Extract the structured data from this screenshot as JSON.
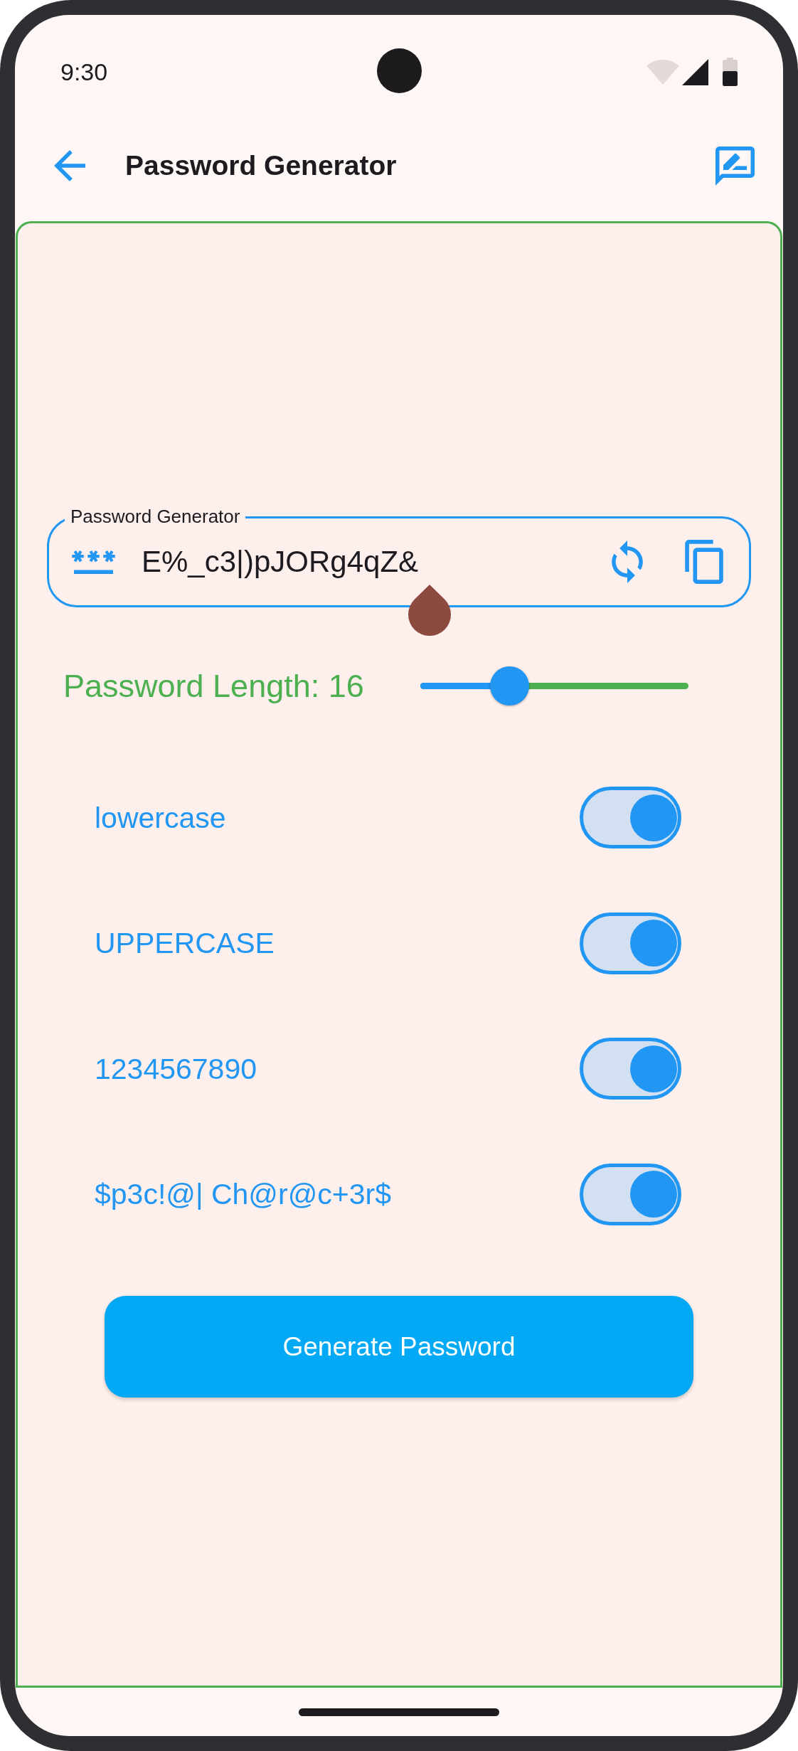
{
  "status_bar": {
    "time": "9:30"
  },
  "app_bar": {
    "title": "Password Generator"
  },
  "password_field": {
    "label": "Password Generator",
    "value": "E%_c3|)pJORg4qZ&",
    "focused": true
  },
  "length": {
    "label": "Password Length: 16",
    "level": 0.333
  },
  "options": [
    {
      "label": "lowercase",
      "on": true
    },
    {
      "label": "UPPERCASE",
      "on": true
    },
    {
      "label": "1234567890",
      "on": true
    },
    {
      "label": "$p3c!@| Ch@r@c+3r$",
      "on": true
    }
  ],
  "generate_button": {
    "label": "Generate Password"
  }
}
